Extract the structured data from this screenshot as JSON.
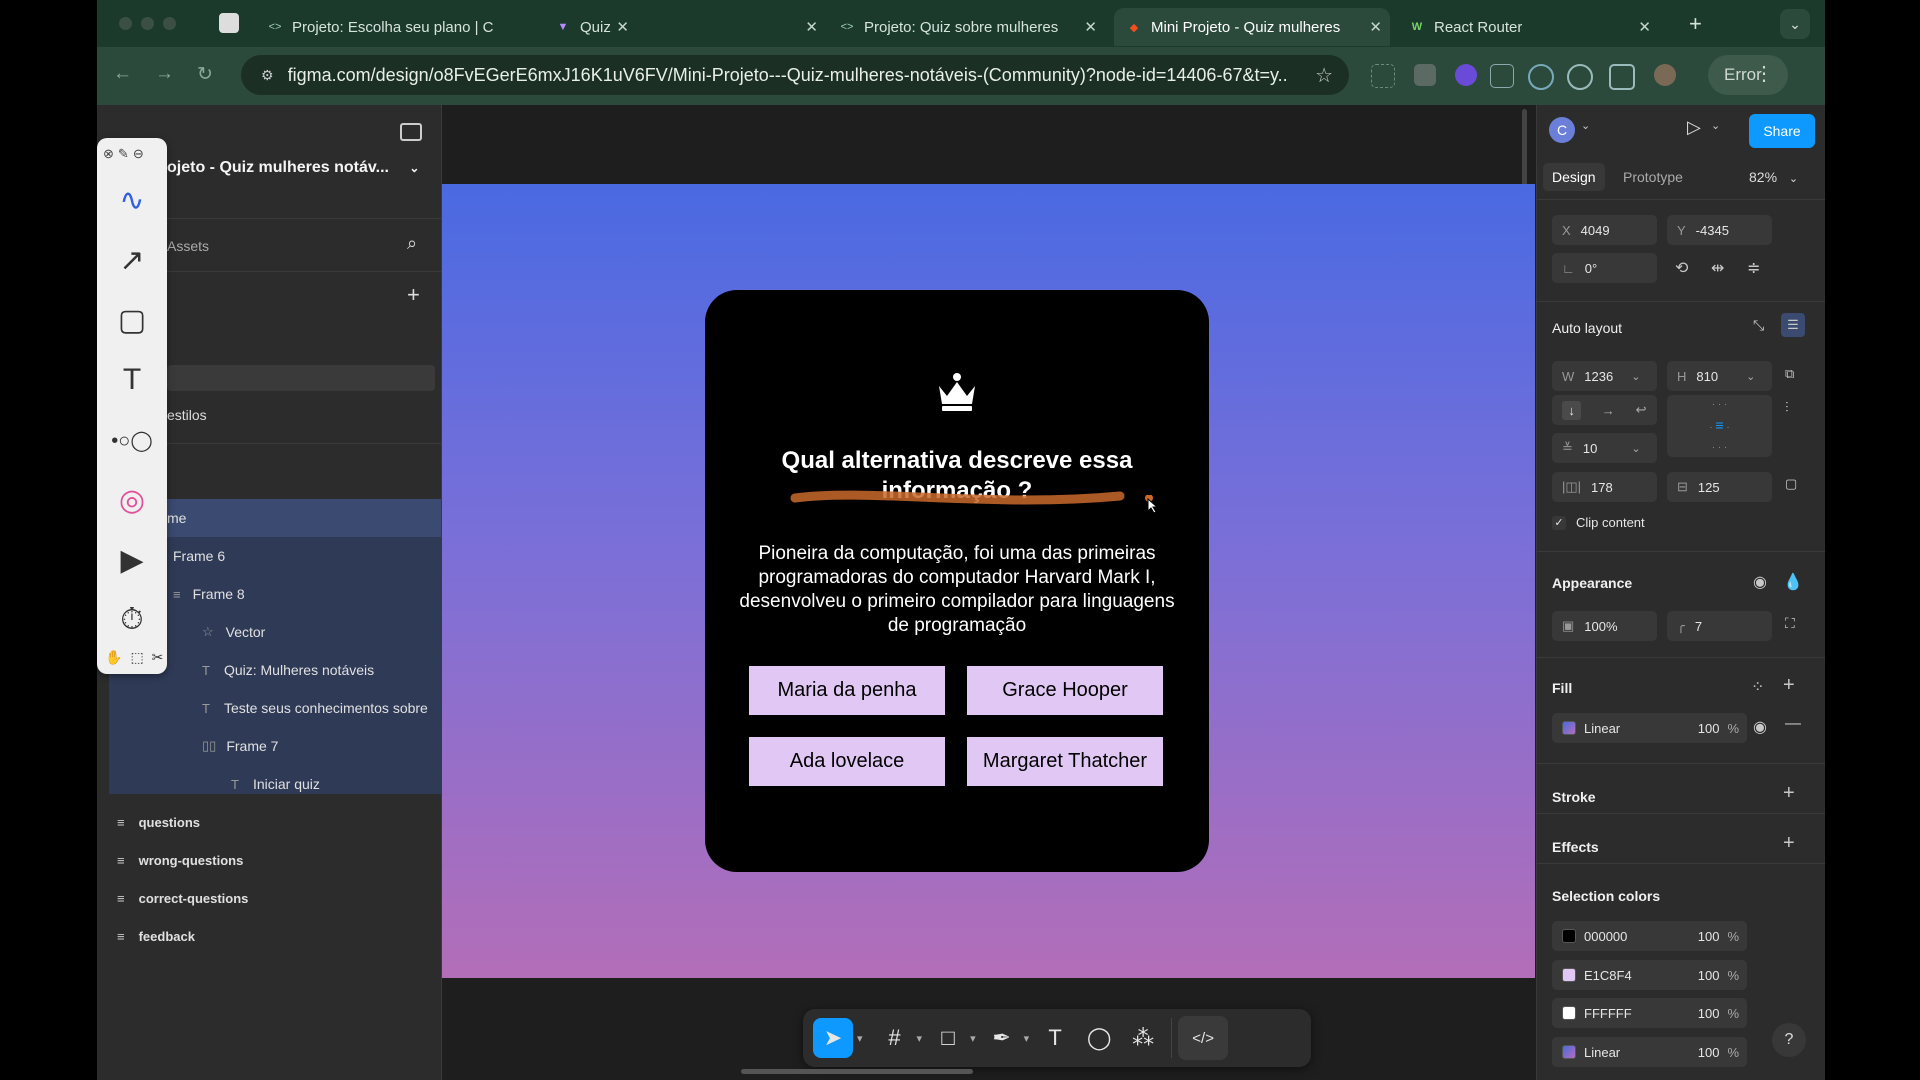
{
  "browser": {
    "tabs": [
      {
        "label": "Projeto: Escolha seu plano | C",
        "icon": "code-icon"
      },
      {
        "label": "Quiz",
        "icon": "vite-icon"
      },
      {
        "label": "Projeto: Quiz sobre mulheres",
        "icon": "code-icon"
      },
      {
        "label": "Mini Projeto - Quiz mulheres",
        "icon": "figma-icon"
      },
      {
        "label": "React Router",
        "icon": "w-icon"
      }
    ],
    "url": "figma.com/design/o8FvEGerE6mxJ16K1uV6FV/Mini-Projeto---Quiz-mulheres-notáveis-(Community)?node-id=14406-67&t=y...",
    "error_label": "Error"
  },
  "left_panel": {
    "project_title": "ojeto - Quiz mulheres notáv...",
    "assets_label": "Assets",
    "estilos_label": "estilos",
    "layers": [
      {
        "label": "me"
      },
      {
        "label": "Frame 6"
      },
      {
        "label": "Frame 8"
      },
      {
        "label": "Vector"
      },
      {
        "label": "Quiz: Mulheres notáveis"
      },
      {
        "label": "Teste seus conhecimentos sobre"
      },
      {
        "label": "Frame 7"
      },
      {
        "label": "Iniciar quiz"
      }
    ],
    "pages": [
      {
        "label": "questions"
      },
      {
        "label": "wrong-questions"
      },
      {
        "label": "correct-questions"
      },
      {
        "label": "feedback"
      }
    ]
  },
  "canvas": {
    "question": "Qual alternativa descreve essa informação ?",
    "description": "Pioneira da computação, foi uma das primeiras programadoras do computador Harvard Mark I, desenvolveu o primeiro compilador para linguagens de programação",
    "answers": [
      "Maria da penha",
      "Grace Hooper",
      "Ada lovelace",
      "Margaret Thatcher"
    ],
    "colors": {
      "card": "#000000",
      "answer_bg": "#E1C8F4",
      "gradient_top": "#4a6ae2",
      "gradient_bottom": "#b36eb8",
      "accent": "#c96a2b"
    }
  },
  "right_panel": {
    "avatar_letter": "C",
    "share_label": "Share",
    "tabs": {
      "design": "Design",
      "prototype": "Prototype"
    },
    "zoom": "82%",
    "x_label": "X",
    "x_value": "4049",
    "y_label": "Y",
    "y_value": "-4345",
    "rotation": "0°",
    "auto_layout_label": "Auto layout",
    "w_label": "W",
    "w_value": "1236",
    "h_label": "H",
    "h_value": "810",
    "gap_value": "10",
    "padding_h": "178",
    "padding_v": "125",
    "clip_content": "Clip content",
    "appearance_label": "Appearance",
    "opacity": "100%",
    "radius": "7",
    "fill_label": "Fill",
    "fill_type": "Linear",
    "fill_opacity": "100",
    "percent": "%",
    "stroke_label": "Stroke",
    "effects_label": "Effects",
    "selection_colors_label": "Selection colors",
    "selection_colors": [
      {
        "label": "000000",
        "value": "100",
        "color": "#000000"
      },
      {
        "label": "E1C8F4",
        "value": "100",
        "color": "#E1C8F4"
      },
      {
        "label": "FFFFFF",
        "value": "100",
        "color": "#FFFFFF"
      },
      {
        "label": "Linear",
        "value": "100",
        "color": "#6a63d8"
      }
    ],
    "help": "?"
  }
}
